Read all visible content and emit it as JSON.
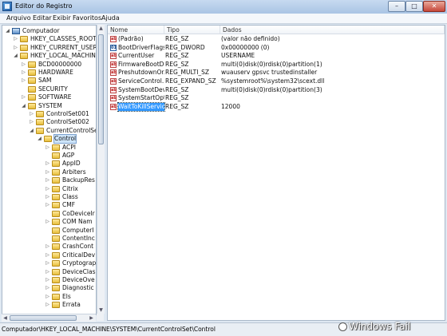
{
  "window": {
    "title": "Editor do Registro",
    "minimize": "–",
    "maximize": "□",
    "close": "✕"
  },
  "menu": [
    "Arquivo",
    "Editar",
    "Exibir",
    "Favoritos",
    "Ajuda"
  ],
  "tree": [
    {
      "label": "Computador",
      "level": 0,
      "icon": "computer-icon",
      "expander": "◢"
    },
    {
      "label": "HKEY_CLASSES_ROOT",
      "level": 1,
      "icon": "folder-icon",
      "expander": "▷"
    },
    {
      "label": "HKEY_CURRENT_USER",
      "level": 1,
      "icon": "folder-icon",
      "expander": "▷"
    },
    {
      "label": "HKEY_LOCAL_MACHINE",
      "level": 1,
      "icon": "folder-icon",
      "expander": "◢"
    },
    {
      "label": "BCD00000000",
      "level": 2,
      "icon": "folder-icon",
      "expander": "▷"
    },
    {
      "label": "HARDWARE",
      "level": 2,
      "icon": "folder-icon",
      "expander": "▷"
    },
    {
      "label": "SAM",
      "level": 2,
      "icon": "folder-icon",
      "expander": "▷"
    },
    {
      "label": "SECURITY",
      "level": 2,
      "icon": "folder-icon",
      "expander": ""
    },
    {
      "label": "SOFTWARE",
      "level": 2,
      "icon": "folder-icon",
      "expander": "▷"
    },
    {
      "label": "SYSTEM",
      "level": 2,
      "icon": "folder-icon",
      "expander": "◢"
    },
    {
      "label": "ControlSet001",
      "level": 3,
      "icon": "folder-icon",
      "expander": "▷"
    },
    {
      "label": "ControlSet002",
      "level": 3,
      "icon": "folder-icon",
      "expander": "▷"
    },
    {
      "label": "CurrentControlSet",
      "level": 3,
      "icon": "folder-icon",
      "expander": "◢"
    },
    {
      "label": "Control",
      "level": 4,
      "icon": "folder-icon",
      "expander": "◢",
      "selected": true
    },
    {
      "label": "ACPI",
      "level": 5,
      "icon": "folder-icon",
      "expander": "▷"
    },
    {
      "label": "AGP",
      "level": 5,
      "icon": "folder-icon",
      "expander": ""
    },
    {
      "label": "AppID",
      "level": 5,
      "icon": "folder-icon",
      "expander": "▷"
    },
    {
      "label": "Arbiters",
      "level": 5,
      "icon": "folder-icon",
      "expander": "▷"
    },
    {
      "label": "BackupRes",
      "level": 5,
      "icon": "folder-icon",
      "expander": "▷"
    },
    {
      "label": "Citrix",
      "level": 5,
      "icon": "folder-icon",
      "expander": "▷"
    },
    {
      "label": "Class",
      "level": 5,
      "icon": "folder-icon",
      "expander": "▷"
    },
    {
      "label": "CMF",
      "level": 5,
      "icon": "folder-icon",
      "expander": "▷"
    },
    {
      "label": "CoDeviceIr",
      "level": 5,
      "icon": "folder-icon",
      "expander": ""
    },
    {
      "label": "COM Nam",
      "level": 5,
      "icon": "folder-icon",
      "expander": "▷"
    },
    {
      "label": "ComputerI",
      "level": 5,
      "icon": "folder-icon",
      "expander": ""
    },
    {
      "label": "ContentInc",
      "level": 5,
      "icon": "folder-icon",
      "expander": ""
    },
    {
      "label": "CrashCont",
      "level": 5,
      "icon": "folder-icon",
      "expander": "▷"
    },
    {
      "label": "CriticalDev",
      "level": 5,
      "icon": "folder-icon",
      "expander": "▷"
    },
    {
      "label": "Cryptograp",
      "level": 5,
      "icon": "folder-icon",
      "expander": "▷"
    },
    {
      "label": "DeviceClas",
      "level": 5,
      "icon": "folder-icon",
      "expander": "▷"
    },
    {
      "label": "DeviceOve",
      "level": 5,
      "icon": "folder-icon",
      "expander": "▷"
    },
    {
      "label": "Diagnostic",
      "level": 5,
      "icon": "folder-icon",
      "expander": "▷"
    },
    {
      "label": "Els",
      "level": 5,
      "icon": "folder-icon",
      "expander": "▷"
    },
    {
      "label": "Errata",
      "level": 5,
      "icon": "folder-icon",
      "expander": "▷"
    }
  ],
  "columns": {
    "name": "Nome",
    "type": "Tipo",
    "data": "Dados"
  },
  "values": [
    {
      "name": "(Padrão)",
      "type": "REG_SZ",
      "data": "(valor não definido)",
      "icon": "ab"
    },
    {
      "name": "BootDriverFlags",
      "type": "REG_DWORD",
      "data": "0x00000000 (0)",
      "icon": "bin"
    },
    {
      "name": "CurrentUser",
      "type": "REG_SZ",
      "data": "USERNAME",
      "icon": "ab"
    },
    {
      "name": "FirmwareBootD...",
      "type": "REG_SZ",
      "data": "multi(0)disk(0)rdisk(0)partition(1)",
      "icon": "ab"
    },
    {
      "name": "PreshutdownOr...",
      "type": "REG_MULTI_SZ",
      "data": "wuauserv gpsvc trustedinstaller",
      "icon": "ab"
    },
    {
      "name": "ServiceControl...",
      "type": "REG_EXPAND_SZ",
      "data": "%systemroot%\\system32\\scext.dll",
      "icon": "ab"
    },
    {
      "name": "SystemBootDevi...",
      "type": "REG_SZ",
      "data": "multi(0)disk(0)rdisk(0)partition(3)",
      "icon": "ab"
    },
    {
      "name": "SystemStartOpti...",
      "type": "REG_SZ",
      "data": "",
      "icon": "ab"
    },
    {
      "name": "WaitToKillServic...",
      "type": "REG_SZ",
      "data": "12000",
      "icon": "ab",
      "selected": true
    }
  ],
  "icon_text": {
    "ab": "ab",
    "bin": "01"
  },
  "status": {
    "path": "Computador\\HKEY_LOCAL_MACHINE\\SYSTEM\\CurrentControlSet\\Control"
  },
  "watermark": "Windows Fail",
  "scrollbar": {
    "up": "▲",
    "down": "▼",
    "left": "◀",
    "right": "▶"
  }
}
